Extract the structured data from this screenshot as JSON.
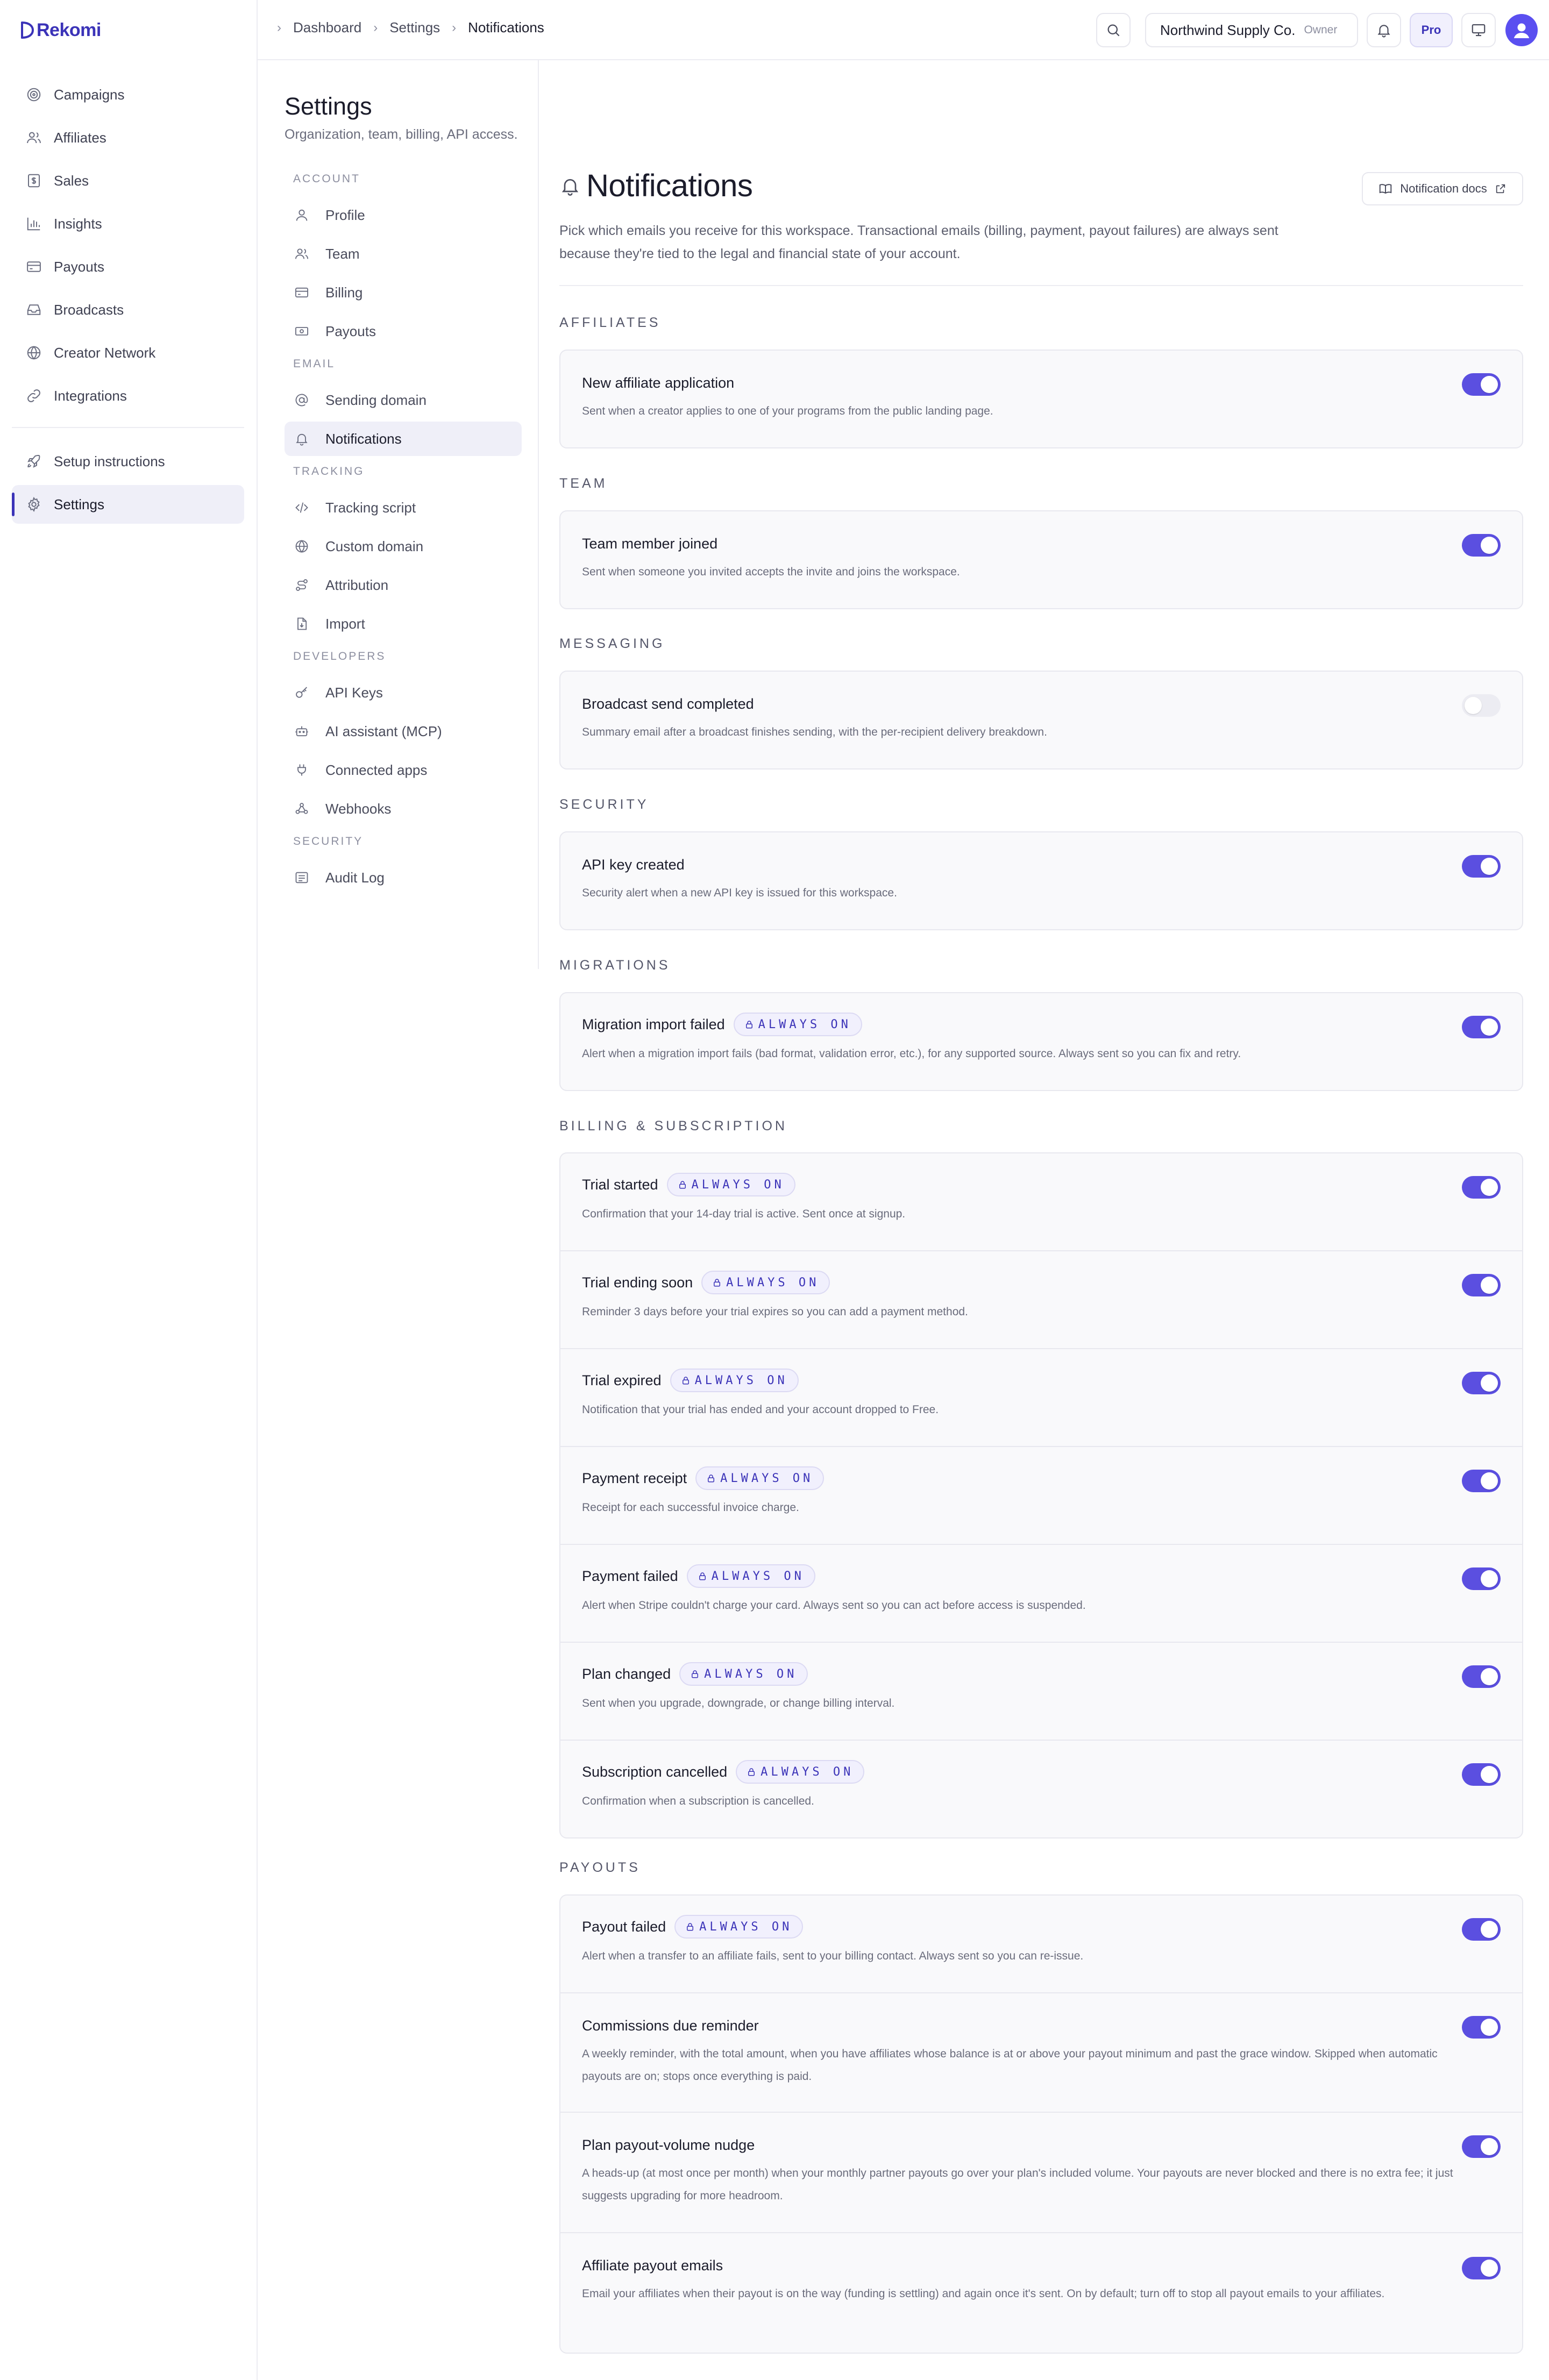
{
  "app": {
    "name": "Rekomi"
  },
  "sidebar": {
    "items": [
      {
        "label": "Campaigns",
        "icon": "target-icon"
      },
      {
        "label": "Affiliates",
        "icon": "users-icon"
      },
      {
        "label": "Sales",
        "icon": "receipt-icon"
      },
      {
        "label": "Insights",
        "icon": "bar-chart-icon"
      },
      {
        "label": "Payouts",
        "icon": "wallet-icon"
      },
      {
        "label": "Broadcasts",
        "icon": "inbox-icon"
      },
      {
        "label": "Creator Network",
        "icon": "globe-icon"
      },
      {
        "label": "Integrations",
        "icon": "link-icon"
      }
    ],
    "bottom_items": [
      {
        "label": "Setup instructions",
        "icon": "rocket-icon"
      },
      {
        "label": "Settings",
        "icon": "gear-icon",
        "active": true
      }
    ]
  },
  "topbar": {
    "breadcrumbs": [
      "Dashboard",
      "Settings",
      "Notifications"
    ],
    "org_name": "Northwind Supply Co.",
    "org_role": "Owner",
    "plan_badge": "Pro"
  },
  "settings_nav": {
    "title": "Settings",
    "subtitle": "Organization, team, billing, API access.",
    "groups": [
      {
        "label": "ACCOUNT",
        "items": [
          "Profile",
          "Team",
          "Billing",
          "Payouts"
        ]
      },
      {
        "label": "EMAIL",
        "items": [
          "Sending domain",
          "Notifications"
        ]
      },
      {
        "label": "TRACKING",
        "items": [
          "Tracking script",
          "Custom domain",
          "Attribution",
          "Import"
        ]
      },
      {
        "label": "DEVELOPERS",
        "items": [
          "API Keys",
          "AI assistant (MCP)",
          "Connected apps",
          "Webhooks"
        ]
      },
      {
        "label": "SECURITY",
        "items": [
          "Audit Log"
        ]
      }
    ],
    "active_item": "Notifications"
  },
  "main": {
    "title": "Notifications",
    "docs_button": "Notification docs",
    "description": "Pick which emails you receive for this workspace. Transactional emails (billing, payment, payout failures) are always sent because they're tied to the legal and financial state of your account.",
    "always_on_label": "ALWAYS ON",
    "accent_color": "#5b4fe0",
    "sections": [
      {
        "label": "AFFILIATES",
        "rows": [
          {
            "title": "New affiliate application",
            "desc": "Sent when a creator applies to one of your programs from the public landing page.",
            "always_on": false,
            "enabled": true
          }
        ]
      },
      {
        "label": "TEAM",
        "rows": [
          {
            "title": "Team member joined",
            "desc": "Sent when someone you invited accepts the invite and joins the workspace.",
            "always_on": false,
            "enabled": true
          }
        ]
      },
      {
        "label": "MESSAGING",
        "rows": [
          {
            "title": "Broadcast send completed",
            "desc": "Summary email after a broadcast finishes sending, with the per-recipient delivery breakdown.",
            "always_on": false,
            "enabled": false
          }
        ]
      },
      {
        "label": "SECURITY",
        "rows": [
          {
            "title": "API key created",
            "desc": "Security alert when a new API key is issued for this workspace.",
            "always_on": false,
            "enabled": true
          }
        ]
      },
      {
        "label": "MIGRATIONS",
        "rows": [
          {
            "title": "Migration import failed",
            "desc": "Alert when a migration import fails (bad format, validation error, etc.), for any supported source. Always sent so you can fix and retry.",
            "always_on": true,
            "enabled": true
          }
        ]
      },
      {
        "label": "BILLING & SUBSCRIPTION",
        "rows": [
          {
            "title": "Trial started",
            "desc": "Confirmation that your 14-day trial is active. Sent once at signup.",
            "always_on": true,
            "enabled": true
          },
          {
            "title": "Trial ending soon",
            "desc": "Reminder 3 days before your trial expires so you can add a payment method.",
            "always_on": true,
            "enabled": true
          },
          {
            "title": "Trial expired",
            "desc": "Notification that your trial has ended and your account dropped to Free.",
            "always_on": true,
            "enabled": true
          },
          {
            "title": "Payment receipt",
            "desc": "Receipt for each successful invoice charge.",
            "always_on": true,
            "enabled": true
          },
          {
            "title": "Payment failed",
            "desc": "Alert when Stripe couldn't charge your card. Always sent so you can act before access is suspended.",
            "always_on": true,
            "enabled": true
          },
          {
            "title": "Plan changed",
            "desc": "Sent when you upgrade, downgrade, or change billing interval.",
            "always_on": true,
            "enabled": true
          },
          {
            "title": "Subscription cancelled",
            "desc": "Confirmation when a subscription is cancelled.",
            "always_on": true,
            "enabled": true
          }
        ]
      },
      {
        "label": "PAYOUTS",
        "rows": [
          {
            "title": "Payout failed",
            "desc": "Alert when a transfer to an affiliate fails, sent to your billing contact. Always sent so you can re-issue.",
            "always_on": true,
            "enabled": true
          },
          {
            "title": "Commissions due reminder",
            "desc": "A weekly reminder, with the total amount, when you have affiliates whose balance is at or above your payout minimum and past the grace window. Skipped when automatic payouts are on; stops once everything is paid.",
            "always_on": false,
            "enabled": true
          },
          {
            "title": "Plan payout-volume nudge",
            "desc": "A heads-up (at most once per month) when your monthly partner payouts go over your plan's included volume. Your payouts are never blocked and there is no extra fee; it just suggests upgrading for more headroom.",
            "always_on": false,
            "enabled": true
          },
          {
            "title": "Affiliate payout emails",
            "desc": "Email your affiliates when their payout is on the way (funding is settling) and again once it's sent. On by default; turn off to stop all payout emails to your affiliates.",
            "always_on": false,
            "enabled": true
          }
        ]
      }
    ]
  }
}
